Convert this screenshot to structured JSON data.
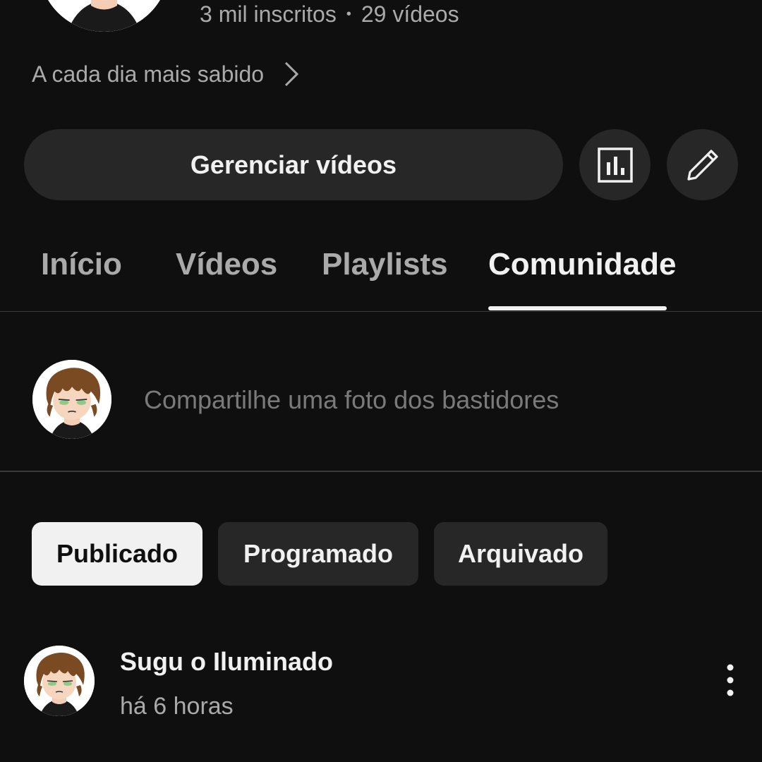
{
  "channel": {
    "subscribers": "3 mil inscritos",
    "separator": "•",
    "videos": "29 vídeos",
    "tagline": "A cada dia mais sabido"
  },
  "actions": {
    "manage_label": "Gerenciar vídeos",
    "analytics_icon": "analytics-icon",
    "edit_icon": "pencil-icon"
  },
  "tabs": [
    {
      "label": "Início"
    },
    {
      "label": "Vídeos"
    },
    {
      "label": "Playlists"
    },
    {
      "label": "Comunidade",
      "active": true
    }
  ],
  "compose": {
    "placeholder": "Compartilhe uma foto dos bastidores"
  },
  "filters": [
    {
      "label": "Publicado",
      "selected": true
    },
    {
      "label": "Programado"
    },
    {
      "label": "Arquivado"
    }
  ],
  "post": {
    "author": "Sugu o Iluminado",
    "time": "há 6 horas"
  },
  "colors": {
    "background": "#0f0f0f",
    "surface": "#272727",
    "text": "#f1f1f1",
    "muted": "#aaaaaa"
  }
}
